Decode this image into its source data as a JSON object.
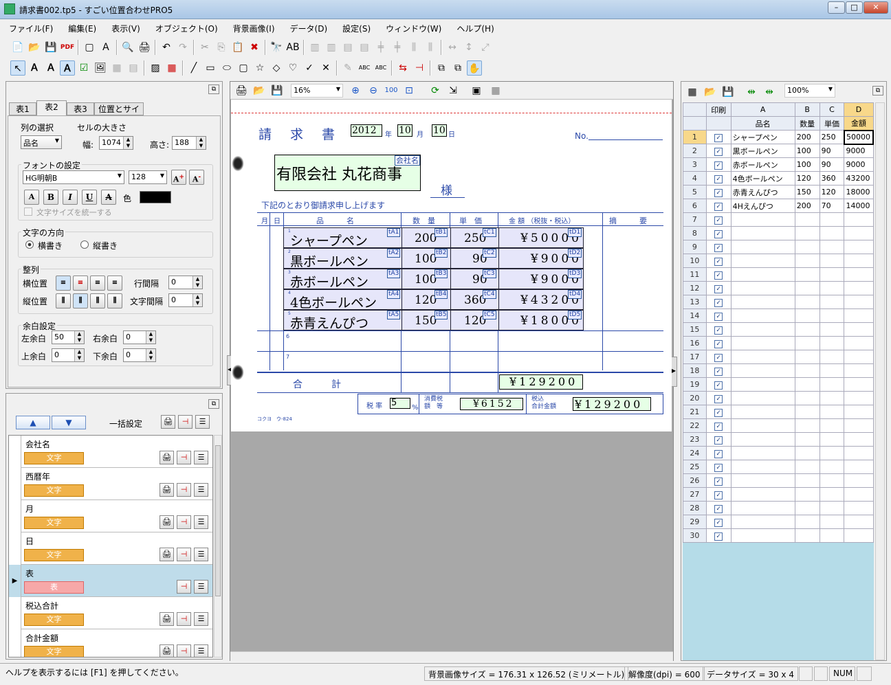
{
  "window": {
    "title": "請求書002.tp5 - すごい位置合わせPRO5"
  },
  "menu": [
    "ファイル(F)",
    "編集(E)",
    "表示(V)",
    "オブジェクト(O)",
    "背景画像(I)",
    "データ(D)",
    "設定(S)",
    "ウィンドウ(W)",
    "ヘルプ(H)"
  ],
  "left": {
    "tabs": [
      "表1",
      "表2",
      "表3",
      "位置とサイズ"
    ],
    "col_select_label": "列の選択",
    "col_select_value": "品名",
    "cell_size_label": "セルの大きさ",
    "width_label": "幅:",
    "width_value": "1074",
    "height_label": "高さ:",
    "height_value": "188",
    "font_label": "フォントの設定",
    "font_name": "HG明朝B",
    "font_size": "128",
    "color_label": "色",
    "unify_label": "文字サイズを統一する",
    "direction_label": "文字の方向",
    "horizontal": "横書き",
    "vertical": "縦書き",
    "align_label": "整列",
    "h_align": "横位置",
    "v_align": "縦位置",
    "line_spacing": "行間隔",
    "line_spacing_value": "0",
    "char_spacing": "文字間隔",
    "char_spacing_value": "0",
    "margin_label": "余白設定",
    "left_margin": "左余白",
    "left_margin_value": "50",
    "right_margin": "右余白",
    "right_margin_value": "0",
    "top_margin": "上余白",
    "top_margin_value": "0",
    "bottom_margin": "下余白",
    "bottom_margin_value": "0",
    "bulk_label": "一括設定",
    "objects": [
      {
        "name": "会社名",
        "type": "文字"
      },
      {
        "name": "西暦年",
        "type": "文字"
      },
      {
        "name": "月",
        "type": "文字"
      },
      {
        "name": "日",
        "type": "文字"
      },
      {
        "name": "表",
        "type": "表"
      },
      {
        "name": "税込合計",
        "type": "文字"
      },
      {
        "name": "合計金額",
        "type": "文字"
      }
    ]
  },
  "center": {
    "zoom": "16%",
    "doc": {
      "title": "請　求　書",
      "year": "2012",
      "year_unit": "年",
      "month": "10",
      "month_unit": "月",
      "day": "10",
      "day_unit": "日",
      "no_label": "No.",
      "company": "有限会社 丸花商事",
      "company_tag": "会社名",
      "sama": "様",
      "intro": "下記のとおり御請求申し上げます",
      "headers": [
        "月",
        "日",
        "品　　　名",
        "数　量",
        "単　価",
        "金 額 （税抜・税込）",
        "摘　　　要"
      ],
      "rows": [
        {
          "n": "1",
          "name": "シャープペン",
          "qty": "200",
          "price": "250",
          "amount": "¥50000",
          "tA": "tA1",
          "tB": "tB1",
          "tC": "tC1",
          "tD": "tD1"
        },
        {
          "n": "2",
          "name": "黒ボールペン",
          "qty": "100",
          "price": "90",
          "amount": "¥9000",
          "tA": "tA2",
          "tB": "tB2",
          "tC": "tC2",
          "tD": "tD2"
        },
        {
          "n": "3",
          "name": "赤ボールペン",
          "qty": "100",
          "price": "90",
          "amount": "¥9000",
          "tA": "tA3",
          "tB": "tB3",
          "tC": "tC3",
          "tD": "tD3"
        },
        {
          "n": "4",
          "name": "4色ボールペン",
          "qty": "120",
          "price": "360",
          "amount": "¥43200",
          "tA": "tA4",
          "tB": "tB4",
          "tC": "tC4",
          "tD": "tD4"
        },
        {
          "n": "5",
          "name": "赤青えんぴつ",
          "qty": "150",
          "price": "120",
          "amount": "¥18000",
          "tA": "tA5",
          "tB": "tB5",
          "tC": "tC5",
          "tD": "tD5"
        }
      ],
      "row6": "6",
      "row7": "7",
      "total_label": "合　　　計",
      "total": "¥129200",
      "tax_rate_label": "税 率",
      "tax_rate": "5",
      "percent": "%",
      "tax_label1": "消費税",
      "tax_label2": "額　等",
      "tax": "¥6152",
      "grand_label1": "税込",
      "grand_label2": "合計金額",
      "grand": "¥129200",
      "footer": "コクヨ　ウ-824"
    }
  },
  "right": {
    "zoom": "100%",
    "col_headers": [
      "印刷",
      "A",
      "B",
      "C",
      "D"
    ],
    "field_headers": [
      "品名",
      "数量",
      "単価",
      "金額"
    ],
    "rows": [
      {
        "n": "1",
        "a": "シャープペン",
        "b": "200",
        "c": "250",
        "d": "50000"
      },
      {
        "n": "2",
        "a": "黒ボールペン",
        "b": "100",
        "c": "90",
        "d": "9000"
      },
      {
        "n": "3",
        "a": "赤ボールペン",
        "b": "100",
        "c": "90",
        "d": "9000"
      },
      {
        "n": "4",
        "a": "4色ボールペン",
        "b": "120",
        "c": "360",
        "d": "43200"
      },
      {
        "n": "5",
        "a": "赤青えんぴつ",
        "b": "150",
        "c": "120",
        "d": "18000"
      },
      {
        "n": "6",
        "a": "4Hえんぴつ",
        "b": "200",
        "c": "70",
        "d": "14000"
      }
    ],
    "row_count": 30
  },
  "status": {
    "help": "ヘルプを表示するには [F1] を押してください。",
    "bg_size": "背景画像サイズ = 176.31 x 126.52 (ミリメートル)",
    "dpi": "解像度(dpi) = 600",
    "data_size": "データサイズ = 30 x 4",
    "num": "NUM"
  }
}
